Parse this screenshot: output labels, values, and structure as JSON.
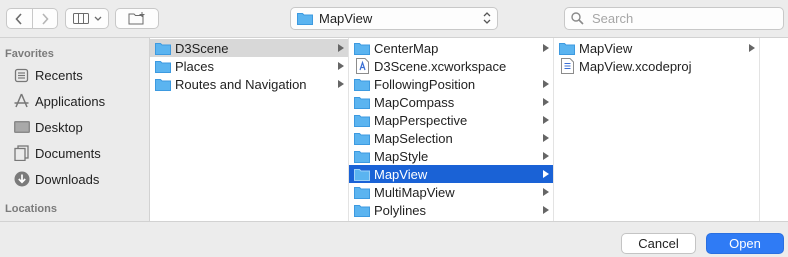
{
  "toolbar": {
    "path_label": "MapView",
    "search_placeholder": "Search"
  },
  "sidebar": {
    "favorites_header": "Favorites",
    "items": [
      {
        "label": "Recents",
        "icon": "clock-list-icon"
      },
      {
        "label": "Applications",
        "icon": "applications-icon"
      },
      {
        "label": "Desktop",
        "icon": "desktop-icon"
      },
      {
        "label": "Documents",
        "icon": "documents-icon"
      },
      {
        "label": "Downloads",
        "icon": "downloads-icon"
      }
    ],
    "locations_header": "Locations"
  },
  "columns": [
    {
      "rows": [
        {
          "label": "D3Scene",
          "icon": "folder-icon",
          "has_children": true,
          "state": "selected-inactive"
        },
        {
          "label": "Places",
          "icon": "folder-icon",
          "has_children": true,
          "state": "normal"
        },
        {
          "label": "Routes and Navigation",
          "icon": "folder-icon",
          "has_children": true,
          "state": "normal"
        }
      ]
    },
    {
      "rows": [
        {
          "label": "CenterMap",
          "icon": "folder-icon",
          "has_children": true,
          "state": "normal"
        },
        {
          "label": "D3Scene.xcworkspace",
          "icon": "xcworkspace-file-icon",
          "has_children": false,
          "state": "normal"
        },
        {
          "label": "FollowingPosition",
          "icon": "folder-icon",
          "has_children": true,
          "state": "normal"
        },
        {
          "label": "MapCompass",
          "icon": "folder-icon",
          "has_children": true,
          "state": "normal"
        },
        {
          "label": "MapPerspective",
          "icon": "folder-icon",
          "has_children": true,
          "state": "normal"
        },
        {
          "label": "MapSelection",
          "icon": "folder-icon",
          "has_children": true,
          "state": "normal"
        },
        {
          "label": "MapStyle",
          "icon": "folder-icon",
          "has_children": true,
          "state": "normal"
        },
        {
          "label": "MapView",
          "icon": "folder-icon",
          "has_children": true,
          "state": "selected-active"
        },
        {
          "label": "MultiMapView",
          "icon": "folder-icon",
          "has_children": true,
          "state": "normal"
        },
        {
          "label": "Polylines",
          "icon": "folder-icon",
          "has_children": true,
          "state": "normal"
        }
      ]
    },
    {
      "rows": [
        {
          "label": "MapView",
          "icon": "folder-icon",
          "has_children": true,
          "state": "normal"
        },
        {
          "label": "MapView.xcodeproj",
          "icon": "xcodeproj-file-icon",
          "has_children": false,
          "state": "normal"
        }
      ]
    }
  ],
  "buttons": {
    "cancel": "Cancel",
    "open": "Open"
  },
  "colors": {
    "selection_active": "#1a62d6",
    "selection_inactive": "#d8d8d8",
    "folder": "#5bb4f0",
    "open_button": "#2f7bf5"
  }
}
